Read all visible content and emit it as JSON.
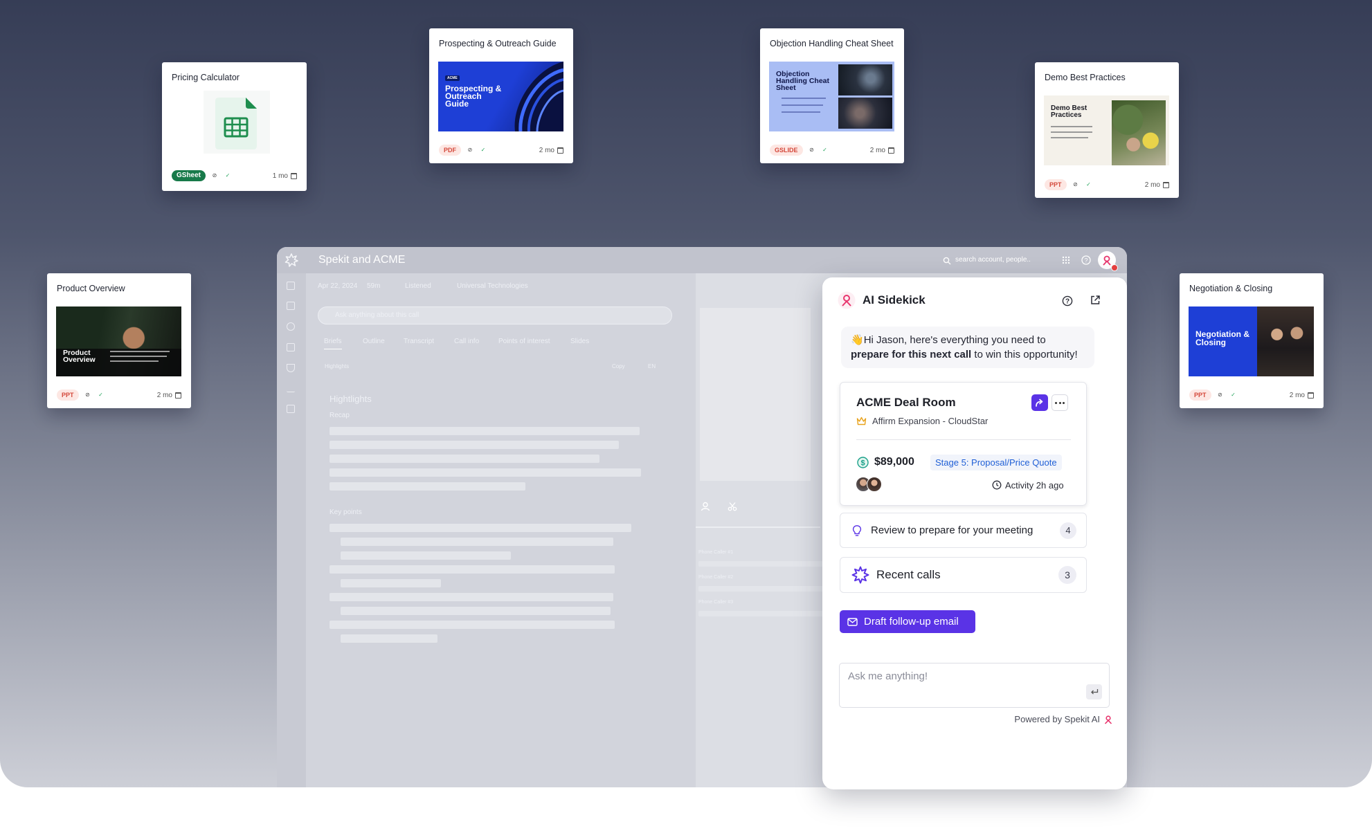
{
  "cards": {
    "pricing": {
      "title": "Pricing Calculator",
      "badge": "GSheet",
      "age": "1 mo"
    },
    "prospecting": {
      "title": "Prospecting & Outreach Guide",
      "badge": "PDF",
      "age": "2 mo",
      "thumb_heading": "Prospecting & Outreach Guide",
      "thumb_tag": "ACME"
    },
    "objection": {
      "title": "Objection Handling Cheat Sheet",
      "badge": "GSLIDE",
      "age": "2 mo",
      "thumb_heading": "Objection Handling Cheat Sheet"
    },
    "demo": {
      "title": "Demo Best Practices",
      "badge": "PPT",
      "age": "2 mo",
      "thumb_heading": "Demo Best Practices"
    },
    "product": {
      "title": "Product Overview",
      "badge": "PPT",
      "age": "2 mo",
      "thumb_heading": "Product Overview"
    },
    "negotiation": {
      "title": "Negotiation & Closing",
      "badge": "PPT",
      "age": "2 mo",
      "thumb_heading": "Negotiation & Closing"
    }
  },
  "app": {
    "title": "Spekit and ACME",
    "search_placeholder": "search account, people..",
    "meta": {
      "date": "Apr 22, 2024",
      "duration": "59m",
      "status": "Listened",
      "company": "Universal Technologies"
    },
    "ask_placeholder": "Ask anything about this call",
    "tabs": [
      "Briefs",
      "Outline",
      "Transcript",
      "Call info",
      "Points of interest",
      "Slides"
    ],
    "filter": "Highlights",
    "copy_label": "Copy",
    "lang": "EN",
    "section_title": "Hightlights",
    "recap": "Recap",
    "key_points": "Key points",
    "callers": [
      "Phone Caller #1",
      "Phone Caller #2",
      "Phone Caller #3"
    ]
  },
  "sidekick": {
    "title": "AI Sidekick",
    "greeting_wave": "👋",
    "greeting_pre": "Hi Jason, here's everything you need to ",
    "greeting_bold": "prepare for this next call",
    "greeting_post": " to win this opportunity!",
    "deal": {
      "name": "ACME Deal Room",
      "subtitle": "Affirm Expansion - CloudStar",
      "amount": "$89,000",
      "stage": "Stage 5: Proposal/Price Quote",
      "activity": "Activity 2h ago"
    },
    "review": {
      "label": "Review to prepare for your meeting",
      "count": "4"
    },
    "recent": {
      "label": "Recent calls",
      "count": "3"
    },
    "draft_button": "Draft follow-up email",
    "ask_placeholder": "Ask me anything!",
    "powered_by": "Powered by Spekit AI"
  },
  "colors": {
    "accent": "#5a33e6",
    "brand_pink": "#e8366e",
    "stage_blue": "#1f5fd6",
    "money_green": "#1aa08a"
  }
}
